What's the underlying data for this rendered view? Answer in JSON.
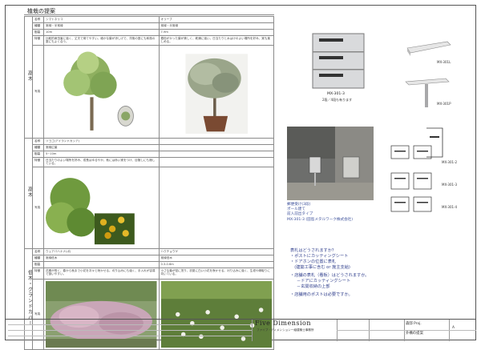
{
  "page": {
    "title": "植栽の提案"
  },
  "labels": {
    "name": "名称",
    "type": "種類",
    "height": "樹高",
    "features": "特徴",
    "photo": "写真"
  },
  "sections": [
    {
      "category": "高木",
      "plants": [
        {
          "name": "シマトネリコ",
          "type": "常緑・半常緑",
          "height": "10m",
          "features": "比較的病虫害に強く、丈夫で育てやすい。細かな葉が涼しげで、洋風の庭にも和風の庭にもよく合う。"
        },
        {
          "name": "オリーブ",
          "type": "常緑・半常緑",
          "height": "7-9m",
          "features": "銀色がかった葉が美しく、乾燥に強い。日当たりと水はけのよい場所を好み、実も楽しめる。"
        }
      ]
    },
    {
      "category": "高木",
      "plants": [
        {
          "name": "ソヨゴ(アイランドカシア)",
          "type": "常緑広葉",
          "height": "5~10m",
          "features": "日当たりのよい場所を好み、成長はゆるやか。秋には赤い実をつけ、目隠しにも適している。"
        },
        {
          "name": "",
          "type": "",
          "height": "",
          "features": ""
        }
      ]
    },
    {
      "category": "低木・グランドカバー",
      "plants": [
        {
          "name": "ウェアバハナナ(ボ)",
          "type": "常緑低木",
          "height": "",
          "features": "花期が長く、春から秋まで小花を次々と咲かせる。刈り込みにも強く、手入れが容易で扱いやすい。"
        },
        {
          "name": "ハクチョウゲ",
          "type": "常緑低木",
          "height": "0.3-0.6m",
          "features": "小さな葉が密に茂り、初夏に白い小花を咲かせる。刈り込みに強く、生垣や縁取りに向いている。"
        }
      ]
    }
  ],
  "mailbox": {
    "model_top": "MX-301-3",
    "model_top_sub": "2段／4段も有ります",
    "model_r1": "MX-301L",
    "model_r2": "MX-301P",
    "caption": [
      "郵便受け(3段)",
      "ポール建て",
      "前入前出タイプ",
      "MX-301-3 (田島メタルワーク株式会社)"
    ],
    "variants": [
      "MX-301-2",
      "MX-301-3",
      "MX-301-4"
    ]
  },
  "questions": {
    "q1": "表札はどうされますか？",
    "q1_items": [
      "・ポストにカッティングシート",
      "・ドアホンの位置に表札",
      "　(建築工事に含む or 施主支給)"
    ],
    "q2": "・店舗の表札（看板）はどうされますか。",
    "q2_items": [
      "－ドアにカッティングシート",
      "－玄関収納の上部"
    ],
    "q3": "・店舗用のポストは必要ですか。"
  },
  "title_block": {
    "company": "Five Dimension",
    "company_sub": "ファイブ・ディメンション一級建築士事務所",
    "project": "森邸 Proj.",
    "drawing": "外構の提案",
    "sheet": "A"
  },
  "colors": {
    "accent": "#3b4f9a",
    "line": "#8a8a8a"
  }
}
